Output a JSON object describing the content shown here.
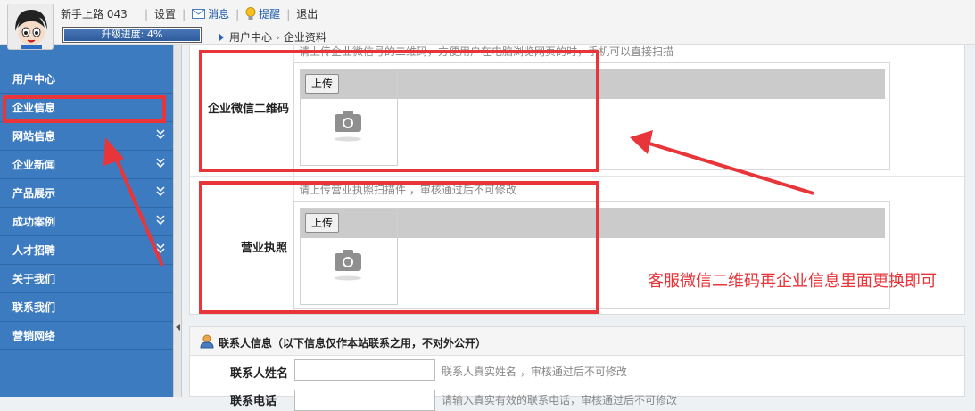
{
  "header": {
    "username": "新手上路 043",
    "nav": {
      "settings": "设置",
      "messages": "消息",
      "reminders": "提醒",
      "logout": "退出"
    },
    "progress_label": "升级进度: 4%",
    "progress_percent": 4
  },
  "breadcrumb": {
    "home": "用户中心",
    "current": "企业资料"
  },
  "sidebar": {
    "items": [
      {
        "label": "用户中心",
        "expandable": false
      },
      {
        "label": "企业信息",
        "expandable": false
      },
      {
        "label": "网站信息",
        "expandable": true
      },
      {
        "label": "企业新闻",
        "expandable": true
      },
      {
        "label": "产品展示",
        "expandable": true
      },
      {
        "label": "成功案例",
        "expandable": true
      },
      {
        "label": "人才招聘",
        "expandable": true
      },
      {
        "label": "关于我们",
        "expandable": false
      },
      {
        "label": "联系我们",
        "expandable": false
      },
      {
        "label": "营销网络",
        "expandable": false
      }
    ]
  },
  "form": {
    "wechat_qr": {
      "label": "企业微信二维码",
      "hint": "请上传企业微信号的二维码，方便用户在电脑浏览网页的时，手机可以直接扫描",
      "upload_label": "上传"
    },
    "business_license": {
      "label": "营业执照",
      "hint": "请上传营业执照扫描件 ，审核通过后不可修改",
      "upload_label": "上传"
    }
  },
  "contact": {
    "title": "联系人信息（以下信息仅作本站联系之用，不对外公开）",
    "name_label": "联系人姓名",
    "name_value": "",
    "name_hint": "联系人真实姓名 ，审核通过后不可修改",
    "phone_label": "联系电话",
    "phone_hint": "请输入真实有效的联系电话，审核通过后不可修改"
  },
  "annotation": {
    "text": "客服微信二维码再企业信息里面更换即可",
    "color": "#e8353a"
  },
  "colors": {
    "sidebar_bg": "#3d7bc1",
    "accent": "#1e5aa8"
  }
}
